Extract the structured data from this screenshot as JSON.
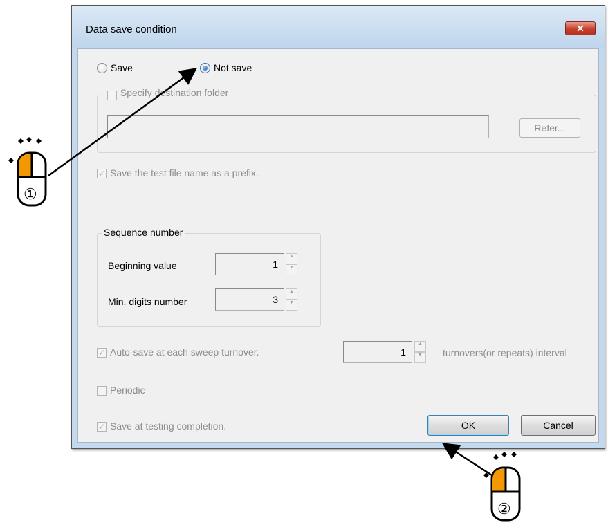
{
  "dialog": {
    "title": "Data save condition",
    "close_label": "✕"
  },
  "save_mode": {
    "save_label": "Save",
    "not_save_label": "Not save",
    "selected": "Not save"
  },
  "destination": {
    "checkbox_label": "Specify destination folder",
    "checked": false,
    "path_value": "",
    "refer_label": "Refer..."
  },
  "prefix": {
    "label": "Save the test file name as a prefix.",
    "checked": true
  },
  "sequence": {
    "group_label": "Sequence number",
    "beginning_label": "Beginning value",
    "beginning_value": "1",
    "min_digits_label": "Min. digits number",
    "min_digits_value": "3"
  },
  "autosave": {
    "label": "Auto-save at each sweep turnover.",
    "checked": true,
    "interval_value": "1",
    "interval_suffix": "turnovers(or repeats) interval"
  },
  "periodic": {
    "label": "Periodic",
    "checked": false
  },
  "completion": {
    "label": "Save at testing completion.",
    "checked": true
  },
  "buttons": {
    "ok_label": "OK",
    "cancel_label": "Cancel"
  },
  "annotations": {
    "step1_marker": "①",
    "step2_marker": "②",
    "mouse_accent_color": "#f39800",
    "arrow_color": "#000000"
  }
}
